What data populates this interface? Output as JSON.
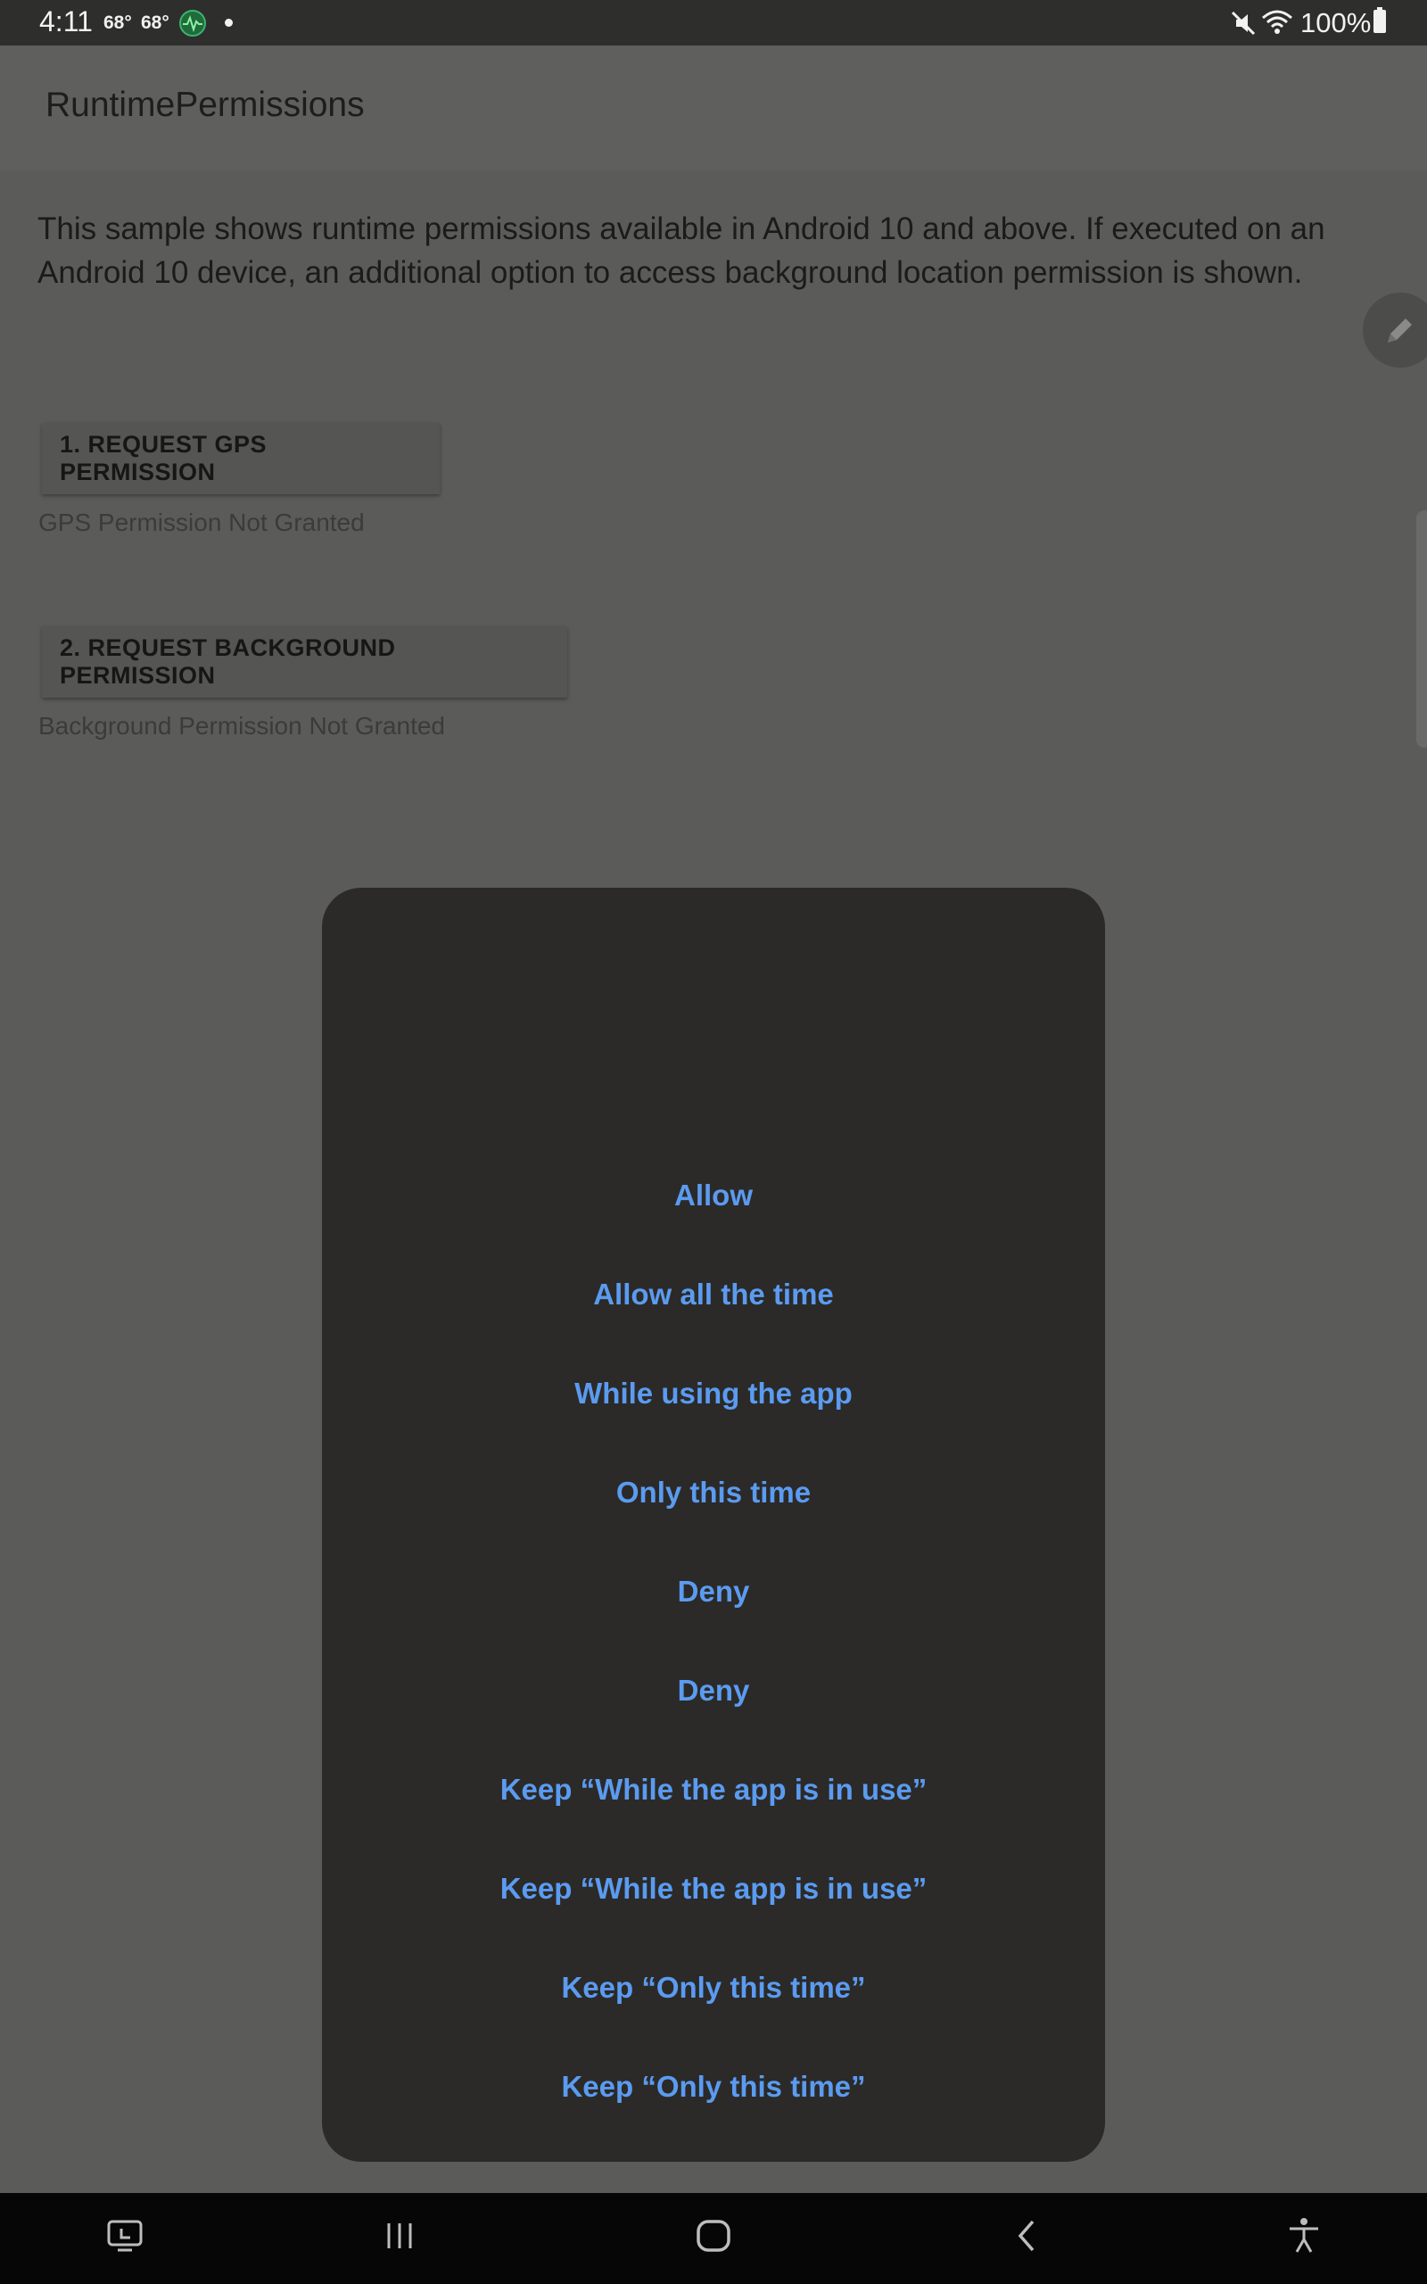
{
  "status_bar": {
    "time": "4:11",
    "temp1": "68°",
    "temp2": "68°",
    "battery": "100%"
  },
  "app_bar": {
    "title": "RuntimePermissions"
  },
  "content": {
    "description": "This sample shows runtime permissions available in Android 10 and above. If executed on an Android 10 device, an additional option to access background location permission is shown.",
    "gps_button": "1. REQUEST GPS PERMISSION",
    "gps_status": "GPS Permission Not Granted",
    "background_button": "2. REQUEST BACKGROUND PERMISSION",
    "background_status": "Background Permission Not Granted"
  },
  "dialog": {
    "options": [
      "Allow",
      "Allow all the time",
      "While using the app",
      "Only this time",
      "Deny",
      "Deny",
      "Keep “While the app is in use”",
      "Keep “While the app is in use”",
      "Keep “Only this time”",
      "Keep “Only this time”"
    ]
  },
  "colors": {
    "dialog_bg": "#2b2a28",
    "option_text": "#5b9bf0",
    "scrim_bg": "#5b5b59"
  },
  "icons": {
    "nav": [
      "recent-apps-screenshot-icon",
      "recents-icon",
      "home-icon",
      "back-icon",
      "accessibility-icon"
    ]
  }
}
